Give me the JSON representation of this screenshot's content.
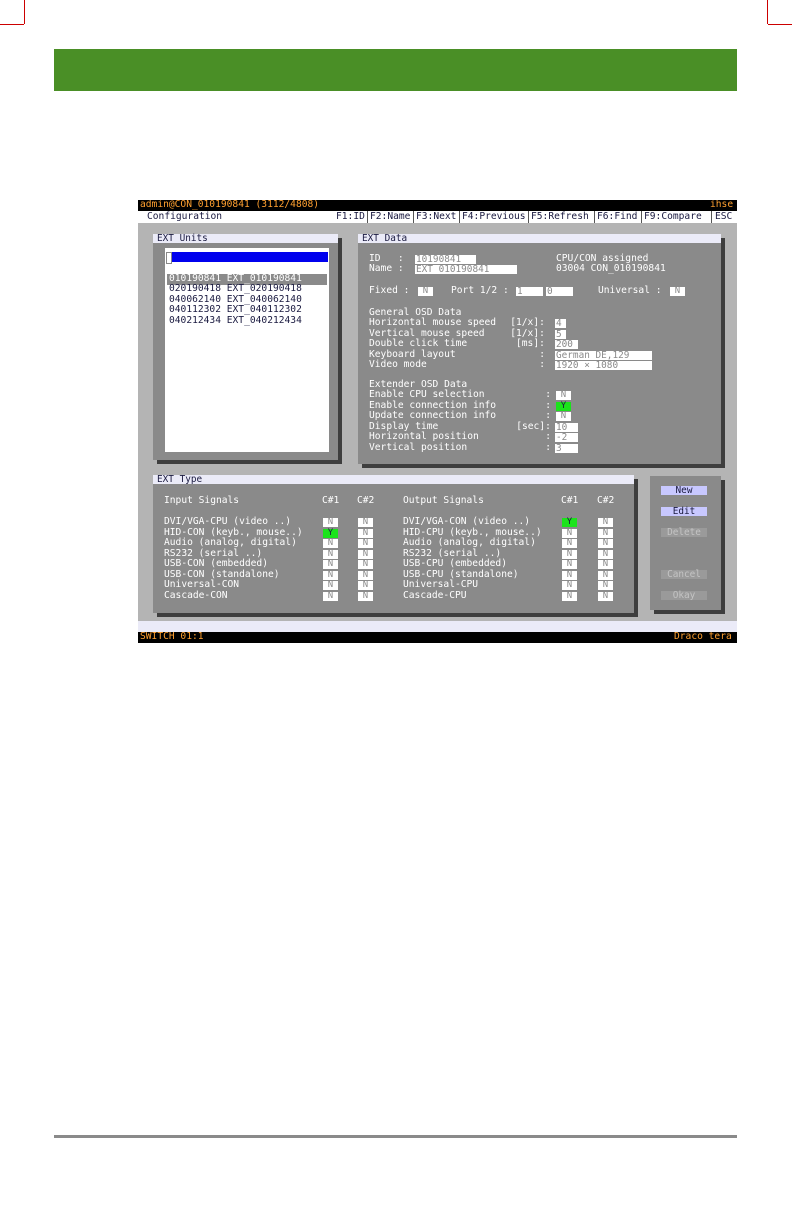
{
  "titlebar": {
    "left": "admin@CON_010190841 (3112/4808)",
    "right": "ihse"
  },
  "menubar": {
    "title": "Configuration",
    "items": [
      "F1:ID",
      "F2:Name",
      "F3:Next",
      "F4:Previous",
      "F5:Refresh",
      "F6:Find",
      "F9:Compare",
      "ESC"
    ]
  },
  "ext_units": {
    "title": "EXT Units",
    "items": [
      "010190841 EXT_010190841",
      "020190418 EXT_020190418",
      "040062140 EXT_040062140",
      "040112302 EXT_040112302",
      "040212434 EXT_040212434"
    ]
  },
  "ext_data": {
    "title": "EXT Data",
    "id_label": "ID   :",
    "id_value": "10190841",
    "name_label": "Name :",
    "name_value": "EXT_010190841",
    "assigned_label": "CPU/CON assigned",
    "assigned_value": "03004 CON_010190841",
    "fixed_label": "Fixed :",
    "fixed_value": "N",
    "port_label": "Port 1/2 :",
    "port1": "1",
    "port2": "0",
    "universal_label": "Universal :",
    "universal_value": "N",
    "general_title": "General OSD Data",
    "general_rows": [
      {
        "label": "Horizontal mouse speed",
        "unit": "[1/x]:",
        "value": "4"
      },
      {
        "label": "Vertical mouse speed",
        "unit": "[1/x]:",
        "value": "5"
      },
      {
        "label": "Double click time",
        "unit": "[ms]:",
        "value": "200"
      },
      {
        "label": "Keyboard layout",
        "unit": ":",
        "value": "German DE,129"
      },
      {
        "label": "Video mode",
        "unit": ":",
        "value": "1920 × 1080"
      }
    ],
    "extender_title": "Extender OSD Data",
    "extender_rows": [
      {
        "label": "Enable CPU selection",
        "unit": ":",
        "value": "N"
      },
      {
        "label": "Enable connection info",
        "unit": ":",
        "value": "Y"
      },
      {
        "label": "Update connection info",
        "unit": ":",
        "value": "N"
      },
      {
        "label": "Display time",
        "unit": "[sec]:",
        "value": "10"
      },
      {
        "label": "Horizontal position",
        "unit": ":",
        "value": "-2"
      },
      {
        "label": "Vertical position",
        "unit": ":",
        "value": "3"
      }
    ]
  },
  "ext_type": {
    "title": "EXT Type",
    "input_header": "Input Signals",
    "output_header": "Output Signals",
    "c1": "C#1",
    "c2": "C#2",
    "inputs": [
      {
        "label": "DVI/VGA-CPU (video ..)",
        "c1": "N",
        "c2": "N"
      },
      {
        "label": "HID-CON (keyb., mouse..)",
        "c1": "Y",
        "c2": "N"
      },
      {
        "label": "Audio (analog, digital)",
        "c1": "N",
        "c2": "N"
      },
      {
        "label": "RS232 (serial ..)",
        "c1": "N",
        "c2": "N"
      },
      {
        "label": "USB-CON (embedded)",
        "c1": "N",
        "c2": "N"
      },
      {
        "label": "USB-CON (standalone)",
        "c1": "N",
        "c2": "N"
      },
      {
        "label": "Universal-CON",
        "c1": "N",
        "c2": "N"
      },
      {
        "label": "Cascade-CON",
        "c1": "N",
        "c2": "N"
      }
    ],
    "outputs": [
      {
        "label": "DVI/VGA-CON (video ..)",
        "c1": "Y",
        "c2": "N"
      },
      {
        "label": "HID-CPU (keyb., mouse..)",
        "c1": "N",
        "c2": "N"
      },
      {
        "label": "Audio (analog, digital)",
        "c1": "N",
        "c2": "N"
      },
      {
        "label": "RS232 (serial ..)",
        "c1": "N",
        "c2": "N"
      },
      {
        "label": "USB-CPU (embedded)",
        "c1": "N",
        "c2": "N"
      },
      {
        "label": "USB-CPU (standalone)",
        "c1": "N",
        "c2": "N"
      },
      {
        "label": "Universal-CPU",
        "c1": "N",
        "c2": "N"
      },
      {
        "label": "Cascade-CPU",
        "c1": "N",
        "c2": "N"
      }
    ]
  },
  "buttons": {
    "new": "New",
    "edit": "Edit",
    "delete": "Delete",
    "cancel": "Cancel",
    "okay": "Okay"
  },
  "statusbar": {
    "left": "SWITCH 01:1",
    "right": "Draco tera"
  },
  "colors": {
    "header_green": "#4a8f26",
    "active_green": "#1be31b",
    "selection_blue": "#0000ee",
    "accent_orange": "#ffa030"
  }
}
